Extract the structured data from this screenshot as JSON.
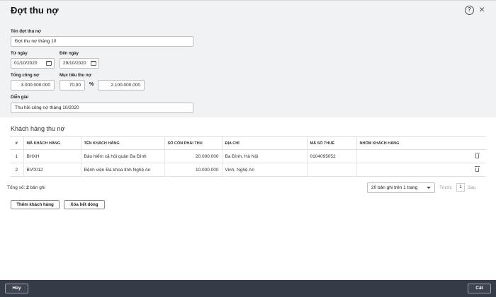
{
  "title": "Đợt thu nợ",
  "form": {
    "name_label": "Tên đợt thu nợ",
    "name_value": "Đợt thu nợ tháng 10",
    "from_label": "Từ ngày",
    "from_value": "01/10/2020",
    "to_label": "Đến ngày",
    "to_value": "29/10/2020",
    "total_debt_label": "Tổng công nợ",
    "total_debt_value": "3.000.000.000",
    "target_label": "Mục tiêu thu nợ",
    "target_percent": "70,00",
    "percent_sign": "%",
    "target_amount": "2.100.000.000",
    "note_label": "Diễn giải",
    "note_value": "Thu hồi công nợ tháng 10/2020"
  },
  "section_title": "Khách hàng thu nợ",
  "table": {
    "headers": [
      "#",
      "MÃ KHÁCH HÀNG",
      "TÊN KHÁCH HÀNG",
      "SỐ CÒN PHẢI THU",
      "ĐỊA CHỈ",
      "MÃ SỐ THUẾ",
      "NHÓM KHÁCH HÀNG"
    ],
    "rows": [
      [
        "1",
        "BHXH",
        "Bảo hiểm xã hội quận Ba Đình",
        "20.000.000",
        "Ba Đình, Hà Nội",
        "0104095052",
        ""
      ],
      [
        "2",
        "BV0012",
        "Bệnh viện Đa khoa tỉnh Nghệ An",
        "10.000.000",
        "Vinh, Nghệ An",
        "",
        ""
      ]
    ]
  },
  "pagination": {
    "total_prefix": "Tổng số:",
    "total_count": "2",
    "total_suffix": "bản ghi",
    "page_size": "20 bản ghi trên 1 trang",
    "prev": "Trước",
    "current": "1",
    "next": "Sau"
  },
  "actions": {
    "add_customer": "Thêm khách hàng",
    "clear_all": "Xóa hết dòng"
  },
  "footer": {
    "cancel": "Hủy",
    "save": "Cất"
  },
  "icons": {
    "help": "?",
    "close": "×"
  }
}
